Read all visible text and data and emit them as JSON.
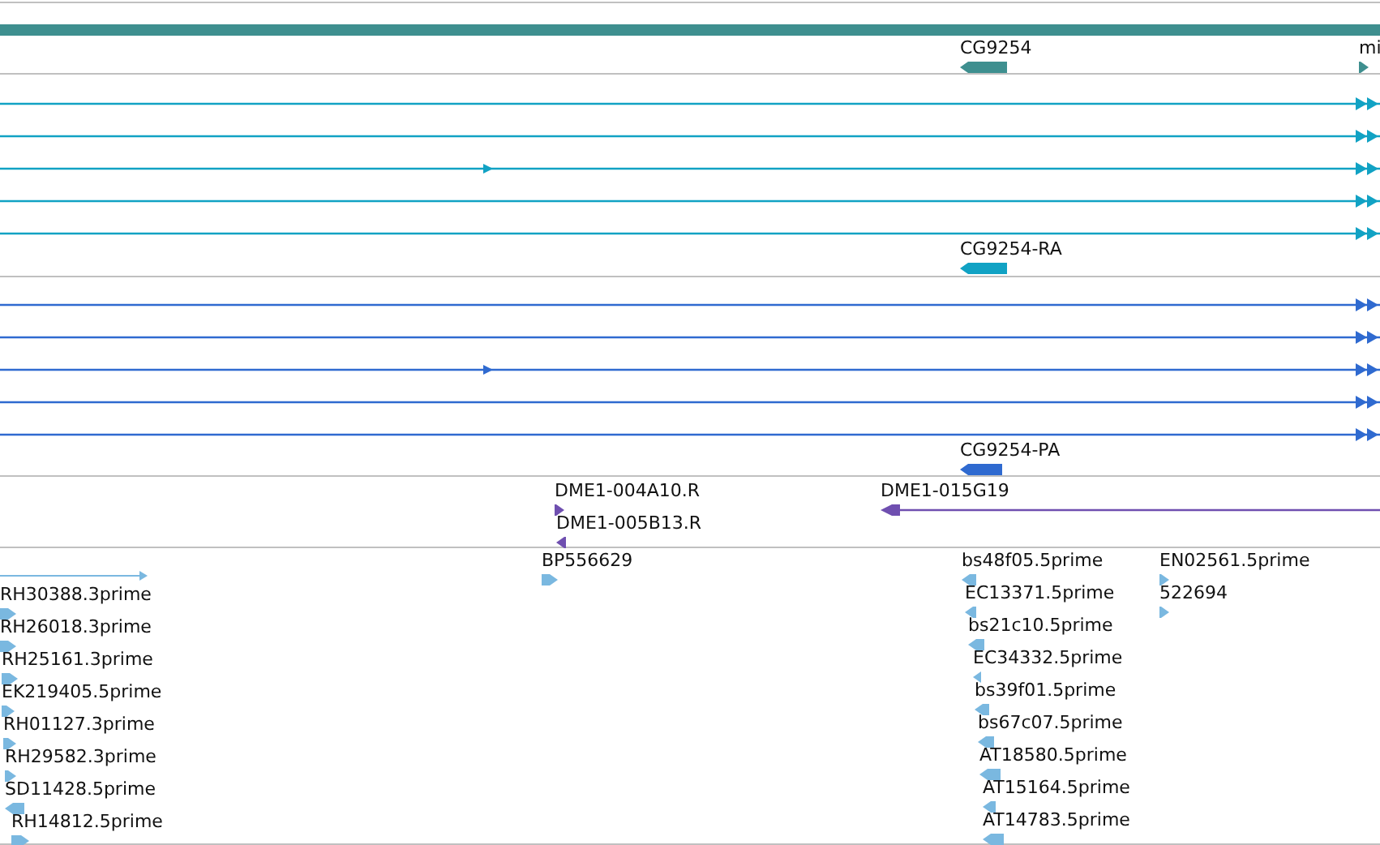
{
  "tracks": [
    {
      "kind": "gene",
      "features": [
        {
          "label": "CG9254",
          "reverse": true
        },
        {
          "label": "mi",
          "reverse": false
        }
      ]
    },
    {
      "kind": "transcript",
      "features": [
        {
          "label": "CG9254-RA",
          "reverse": true
        }
      ]
    },
    {
      "kind": "protein",
      "features": [
        {
          "label": "CG9254-PA",
          "reverse": true
        }
      ]
    },
    {
      "kind": "probe",
      "features": [
        {
          "label": "DME1-004A10.R",
          "reverse": false
        },
        {
          "label": "DME1-005B13.R",
          "reverse": true
        },
        {
          "label": "DME1-015G19",
          "reverse": true
        }
      ]
    },
    {
      "kind": "est",
      "features": [
        {
          "label": "BP556629",
          "reverse": false
        },
        {
          "label": "bs48f05.5prime",
          "reverse": true
        },
        {
          "label": "EN02561.5prime",
          "reverse": false
        },
        {
          "label": "RH30388.3prime",
          "reverse": false
        },
        {
          "label": "EC13371.5prime",
          "reverse": true
        },
        {
          "label": "522694",
          "reverse": false
        },
        {
          "label": "RH26018.3prime",
          "reverse": false
        },
        {
          "label": "bs21c10.5prime",
          "reverse": true
        },
        {
          "label": "RH25161.3prime",
          "reverse": false
        },
        {
          "label": "EC34332.5prime",
          "reverse": true
        },
        {
          "label": "EK219405.5prime",
          "reverse": false
        },
        {
          "label": "bs39f01.5prime",
          "reverse": true
        },
        {
          "label": "RH01127.3prime",
          "reverse": false
        },
        {
          "label": "bs67c07.5prime",
          "reverse": true
        },
        {
          "label": "RH29582.3prime",
          "reverse": false
        },
        {
          "label": "AT18580.5prime",
          "reverse": true
        },
        {
          "label": "SD11428.5prime",
          "reverse": true
        },
        {
          "label": "AT15164.5prime",
          "reverse": true
        },
        {
          "label": "RH14812.5prime",
          "reverse": false
        },
        {
          "label": "AT14783.5prime",
          "reverse": true
        }
      ]
    }
  ]
}
